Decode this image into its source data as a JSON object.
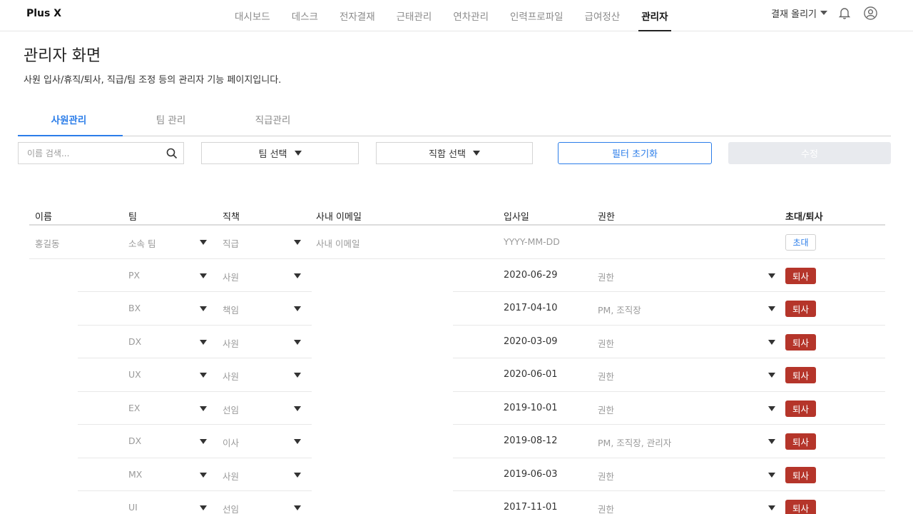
{
  "app": {
    "logo": "Plus X"
  },
  "nav": {
    "items": [
      "대시보드",
      "데스크",
      "전자결재",
      "근태관리",
      "연차관리",
      "인력프로파일",
      "급여정산",
      "관리자"
    ],
    "active_index": 7
  },
  "top_right": {
    "approve_label": "결재 올리기"
  },
  "header": {
    "title": "관리자 화면",
    "description": "사원 입사/휴직/퇴사, 직급/팀 조정 등의 관리자 기능 페이지입니다."
  },
  "tabs": {
    "items": [
      "사원관리",
      "팀 관리",
      "직급관리"
    ],
    "active_index": 0
  },
  "filters": {
    "search_placeholder": "이름 검색...",
    "team_select": "팀 선택",
    "position_select": "직함 선택",
    "reset_label": "필터 초기화",
    "edit_label": "수정"
  },
  "table": {
    "headers": {
      "name": "이름",
      "team": "팀",
      "position": "직책",
      "email": "사내 이메일",
      "join_date": "입사일",
      "permission": "권한",
      "action": "초대/퇴사"
    },
    "new_row": {
      "name": "홍길동",
      "team": "소속 팀",
      "position": "직급",
      "email": "사내 이메일",
      "join_date": "YYYY-MM-DD",
      "action": "초대"
    },
    "rows": [
      {
        "team": "PX",
        "position": "사원",
        "join_date": "2020-06-29",
        "permission": "권한",
        "action": "퇴사"
      },
      {
        "team": "BX",
        "position": "책임",
        "join_date": "2017-04-10",
        "permission": "PM, 조직장",
        "action": "퇴사"
      },
      {
        "team": "DX",
        "position": "사원",
        "join_date": "2020-03-09",
        "permission": "권한",
        "action": "퇴사"
      },
      {
        "team": "UX",
        "position": "사원",
        "join_date": "2020-06-01",
        "permission": "권한",
        "action": "퇴사"
      },
      {
        "team": "EX",
        "position": "선임",
        "join_date": "2019-10-01",
        "permission": "권한",
        "action": "퇴사"
      },
      {
        "team": "DX",
        "position": "이사",
        "join_date": "2019-08-12",
        "permission": "PM, 조직장, 관리자",
        "action": "퇴사"
      },
      {
        "team": "MX",
        "position": "사원",
        "join_date": "2019-06-03",
        "permission": "권한",
        "action": "퇴사"
      },
      {
        "team": "UI",
        "position": "선임",
        "join_date": "2017-11-01",
        "permission": "권한",
        "action": "퇴사"
      }
    ]
  },
  "icons": {
    "bell": "bell-icon",
    "user": "user-circle-icon",
    "search": "search-icon",
    "dropdown": "caret-down-icon"
  },
  "colors": {
    "accent": "#2b7de9",
    "danger": "#b5352a",
    "disabled": "#e8eaee"
  }
}
